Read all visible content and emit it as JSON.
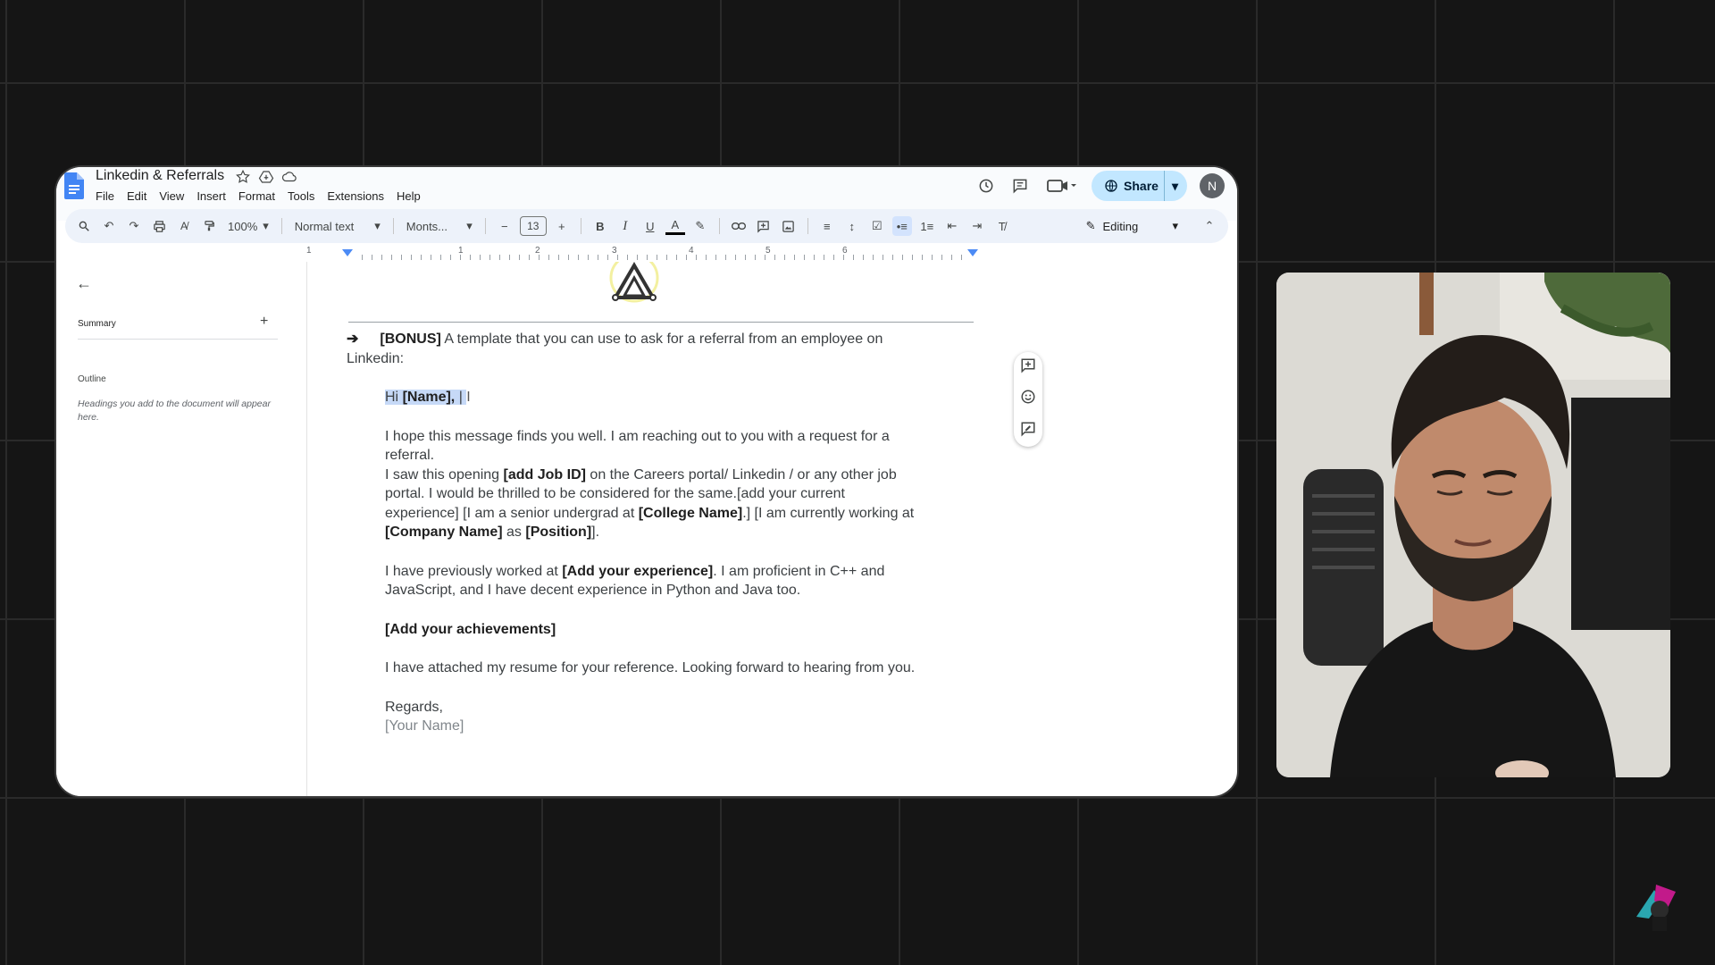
{
  "doc": {
    "title": "Linkedin & Referrals",
    "menu": [
      "File",
      "Edit",
      "View",
      "Insert",
      "Format",
      "Tools",
      "Extensions",
      "Help"
    ],
    "share_label": "Share",
    "avatar_initial": "N"
  },
  "toolbar": {
    "zoom": "100%",
    "style": "Normal text",
    "font": "Monts...",
    "font_size": "13",
    "mode": "Editing"
  },
  "ruler": {
    "numbers": [
      "1",
      "1",
      "2",
      "3",
      "4",
      "5",
      "6"
    ]
  },
  "outline": {
    "summary_label": "Summary",
    "outline_label": "Outline",
    "hint": "Headings you add to the document will appear here."
  },
  "body": {
    "bonus_tag": "[BONUS]",
    "bonus_text": " A template that you can use to ask for a referral from an employee on Linkedin:",
    "greeting_hi": "Hi ",
    "greeting_name": "[Name],",
    "p1": "I hope this message finds you well. I am reaching out to you with a request for a referral.",
    "p2_a": "I saw this opening ",
    "p2_b": "[add Job ID]",
    "p2_c": " on the Careers portal/ Linkedin / or any other job portal. I would be thrilled to be considered for the same.[add your current experience] [I am a senior undergrad at ",
    "p2_d": "[College Name]",
    "p2_e": ".] [I am currently working at ",
    "p2_f": "[Company Name]",
    "p2_g": " as ",
    "p2_h": "[Position]",
    "p2_i": "].",
    "p3_a": "I have previously worked at ",
    "p3_b": "[Add your experience]",
    "p3_c": ". I am proficient in C++ and JavaScript, and I have decent experience in Python and Java too.",
    "achievements": "[Add your achievements]",
    "p4": "I have attached my resume for your reference. Looking forward to hearing from you.",
    "regards": "Regards,",
    "your_name": "[Your Name]"
  },
  "colors": {
    "background": "#151515",
    "share": "#c2e7ff",
    "selection": "#c6d9f7",
    "docs_blue": "#4285f4"
  }
}
